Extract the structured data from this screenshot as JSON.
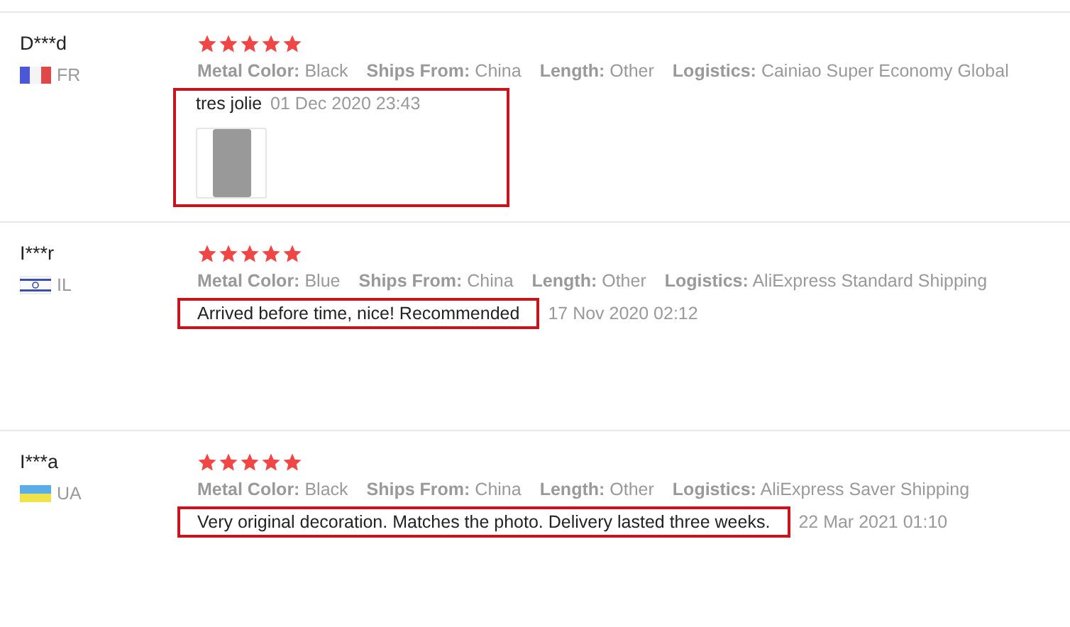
{
  "reviews": [
    {
      "name": "D***d",
      "country": "FR",
      "flag": {
        "kind": "france"
      },
      "stars": 5,
      "attributes": [
        {
          "label": "Metal Color:",
          "value": "Black"
        },
        {
          "label": "Ships From:",
          "value": "China"
        },
        {
          "label": "Length:",
          "value": "Other"
        },
        {
          "label": "Logistics:",
          "value": "Cainiao Super Economy Global"
        }
      ],
      "text": "tres jolie",
      "date": "01 Dec 2020 23:43",
      "has_photo": true,
      "highlight": {
        "kind": "whole"
      }
    },
    {
      "name": "I***r",
      "country": "IL",
      "flag": {
        "kind": "israel"
      },
      "stars": 5,
      "attributes": [
        {
          "label": "Metal Color:",
          "value": "Blue"
        },
        {
          "label": "Ships From:",
          "value": "China"
        },
        {
          "label": "Length:",
          "value": "Other"
        },
        {
          "label": "Logistics:",
          "value": "AliExpress Standard Shipping"
        }
      ],
      "text": "Arrived before time, nice! Recommended",
      "date": "17 Nov 2020 02:12",
      "has_photo": false,
      "highlight": {
        "kind": "text"
      }
    },
    {
      "name": "I***a",
      "country": "UA",
      "flag": {
        "kind": "ukraine"
      },
      "stars": 5,
      "attributes": [
        {
          "label": "Metal Color:",
          "value": "Black"
        },
        {
          "label": "Ships From:",
          "value": "China"
        },
        {
          "label": "Length:",
          "value": "Other"
        },
        {
          "label": "Logistics:",
          "value": "AliExpress Saver Shipping"
        }
      ],
      "text": "Very original decoration. Matches the photo. Delivery lasted three weeks.",
      "date": "22 Mar 2021 01:10",
      "has_photo": false,
      "highlight": {
        "kind": "text"
      }
    }
  ]
}
